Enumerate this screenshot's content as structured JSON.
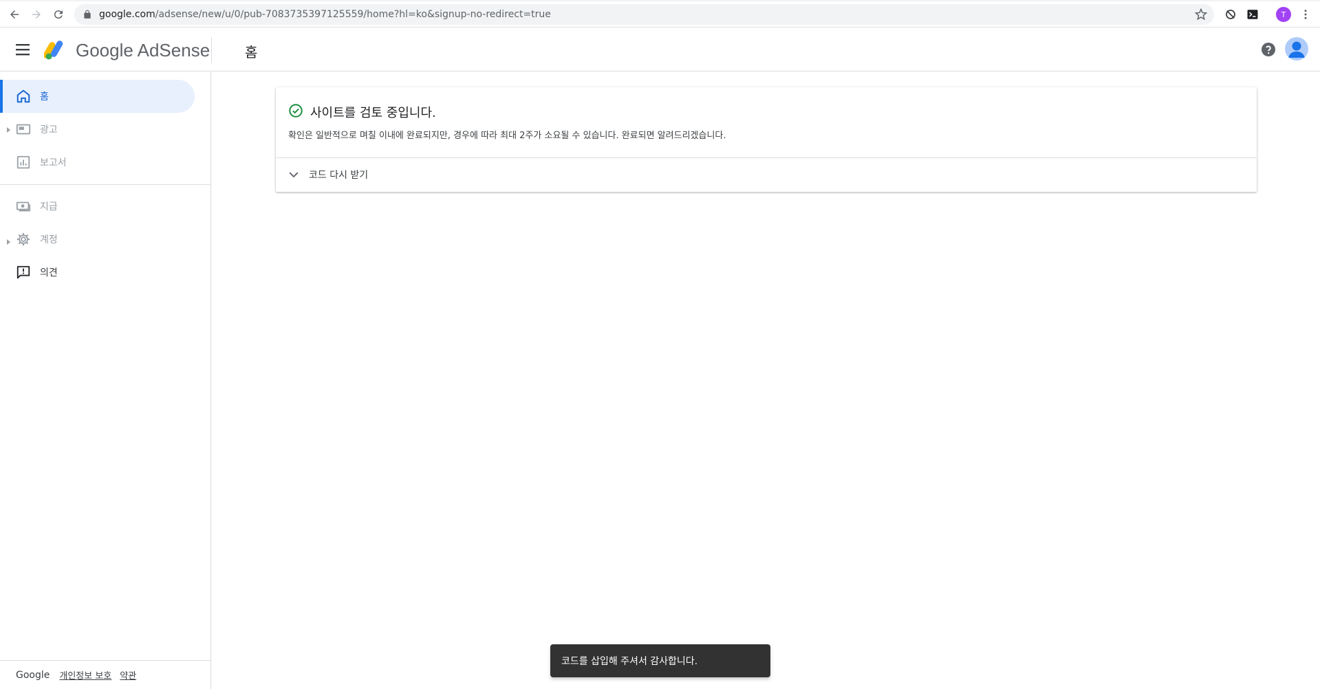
{
  "browser": {
    "url_host": "google.com",
    "url_path": "/adsense/new/u/0/pub-7083735397125559/home?hl=ko&signup-no-redirect=true",
    "profile_initial": "T"
  },
  "header": {
    "brand": "Google AdSense",
    "page_title": "홈"
  },
  "sidebar": {
    "items": [
      {
        "label": "홈",
        "icon": "home-icon",
        "state": "active"
      },
      {
        "label": "광고",
        "icon": "ads-icon",
        "state": "disabled"
      },
      {
        "label": "보고서",
        "icon": "reports-icon",
        "state": "disabled"
      },
      {
        "label": "지급",
        "icon": "payments-icon",
        "state": "disabled"
      },
      {
        "label": "계정",
        "icon": "gear-icon",
        "state": "disabled"
      },
      {
        "label": "의견",
        "icon": "feedback-icon",
        "state": "enabled"
      }
    ],
    "footer": {
      "google": "Google",
      "privacy": "개인정보 보호",
      "terms": "약관"
    }
  },
  "card": {
    "title": "사이트를 검토 중입니다.",
    "description": "확인은 일반적으로 며칠 이내에 완료되지만, 경우에 따라 최대 2주가 소요될 수 있습니다. 완료되면 알려드리겠습니다.",
    "expander_label": "코드 다시 받기"
  },
  "snackbar": {
    "message": "코드를 삽입해 주셔서 감사합니다."
  },
  "colors": {
    "accent": "#1a73e8",
    "success": "#1e8e3e",
    "snackbar_bg": "#323232"
  }
}
